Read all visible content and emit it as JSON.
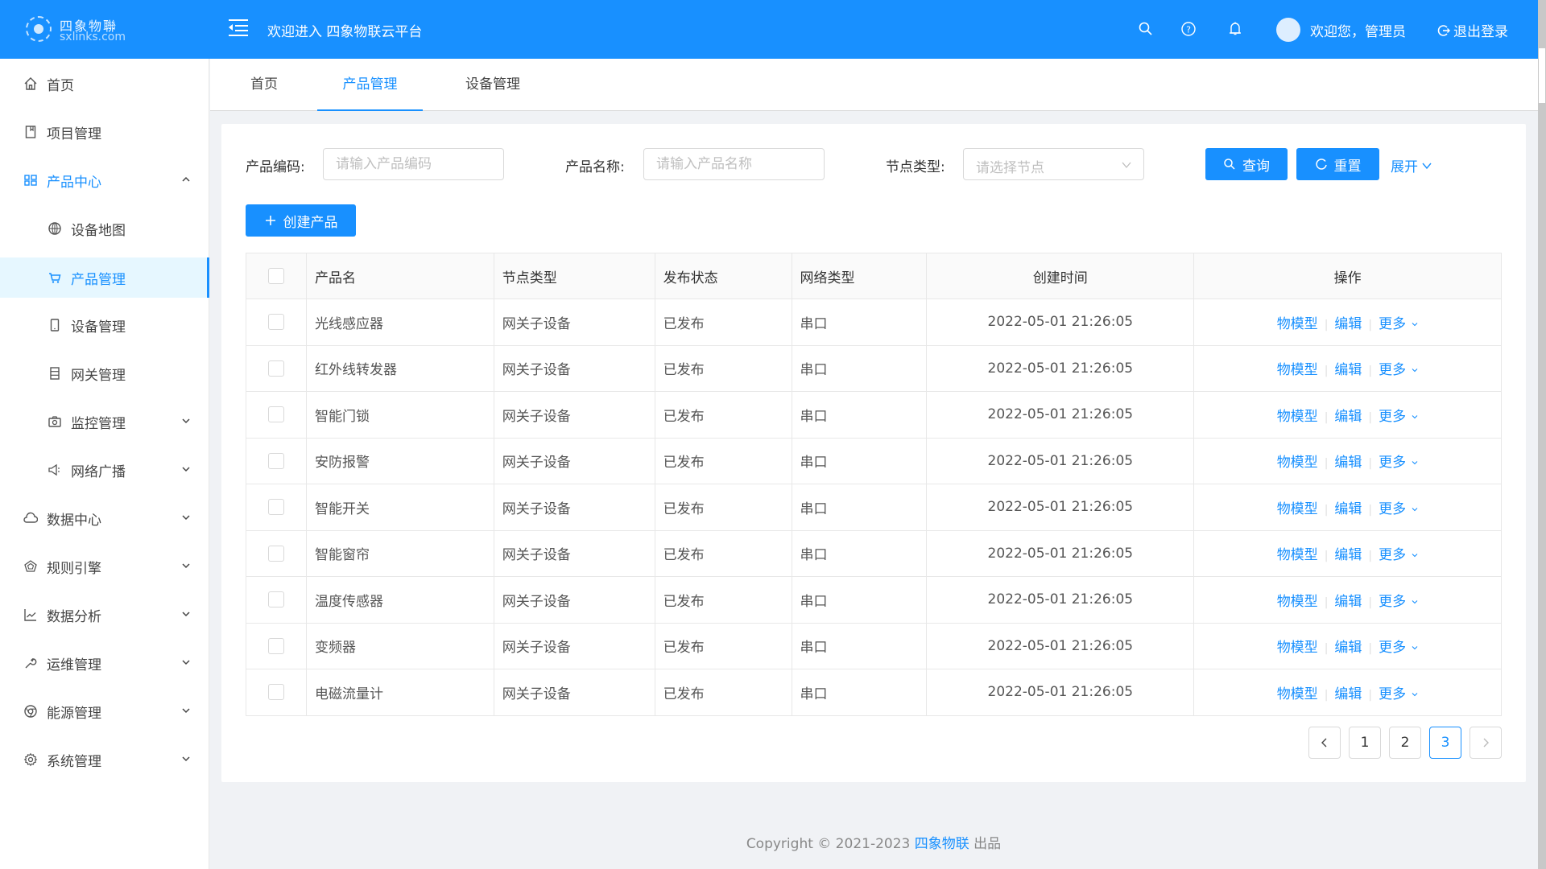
{
  "header": {
    "logo_cn": "四象物聯",
    "logo_en": "sxlinks.com",
    "title": "欢迎进入 四象物联云平台",
    "welcome": "欢迎您，管理员",
    "logout": "退出登录",
    "icons": [
      "menu-fold-icon",
      "search-icon",
      "help-icon",
      "bell-icon",
      "logout-icon"
    ]
  },
  "sidebar": {
    "items": [
      {
        "label": "首页",
        "icon": "home-icon"
      },
      {
        "label": "项目管理",
        "icon": "book-icon"
      },
      {
        "label": "产品中心",
        "icon": "appstore-icon",
        "expanded": true
      },
      {
        "label": "设备地图",
        "icon": "globe-icon"
      },
      {
        "label": "产品管理",
        "icon": "cart-icon",
        "active": true
      },
      {
        "label": "设备管理",
        "icon": "mobile-icon"
      },
      {
        "label": "网关管理",
        "icon": "server-icon"
      },
      {
        "label": "监控管理",
        "icon": "camera-icon"
      },
      {
        "label": "网络广播",
        "icon": "sound-icon"
      },
      {
        "label": "数据中心",
        "icon": "cloud-icon"
      },
      {
        "label": "规则引擎",
        "icon": "radar-icon"
      },
      {
        "label": "数据分析",
        "icon": "line-chart-icon"
      },
      {
        "label": "运维管理",
        "icon": "tool-icon"
      },
      {
        "label": "能源管理",
        "icon": "chrome-icon"
      },
      {
        "label": "系统管理",
        "icon": "setting-icon"
      }
    ]
  },
  "tabs": [
    {
      "label": "首页"
    },
    {
      "label": "产品管理",
      "active": true
    },
    {
      "label": "设备管理"
    }
  ],
  "filters": {
    "code_label": "产品编码:",
    "code_placeholder": "请输入产品编码",
    "name_label": "产品名称:",
    "name_placeholder": "请输入产品名称",
    "node_label": "节点类型:",
    "node_placeholder": "请选择节点",
    "query": "查询",
    "reset": "重置",
    "expand": "展开"
  },
  "create_button": "创建产品",
  "table": {
    "columns": [
      "产品名",
      "节点类型",
      "发布状态",
      "网络类型",
      "创建时间",
      "操作"
    ],
    "rows": [
      {
        "name": "光线感应器",
        "node": "网关子设备",
        "status": "已发布",
        "network": "串口",
        "created": "2022-05-01 21:26:05"
      },
      {
        "name": "红外线转发器",
        "node": "网关子设备",
        "status": "已发布",
        "network": "串口",
        "created": "2022-05-01 21:26:05"
      },
      {
        "name": "智能门锁",
        "node": "网关子设备",
        "status": "已发布",
        "network": "串口",
        "created": "2022-05-01 21:26:05"
      },
      {
        "name": "安防报警",
        "node": "网关子设备",
        "status": "已发布",
        "network": "串口",
        "created": "2022-05-01 21:26:05"
      },
      {
        "name": "智能开关",
        "node": "网关子设备",
        "status": "已发布",
        "network": "串口",
        "created": "2022-05-01 21:26:05"
      },
      {
        "name": "智能窗帘",
        "node": "网关子设备",
        "status": "已发布",
        "network": "串口",
        "created": "2022-05-01 21:26:05"
      },
      {
        "name": "温度传感器",
        "node": "网关子设备",
        "status": "已发布",
        "network": "串口",
        "created": "2022-05-01 21:26:05"
      },
      {
        "name": "变频器",
        "node": "网关子设备",
        "status": "已发布",
        "network": "串口",
        "created": "2022-05-01 21:26:05"
      },
      {
        "name": "电磁流量计",
        "node": "网关子设备",
        "status": "已发布",
        "network": "串口",
        "created": "2022-05-01 21:26:05"
      }
    ],
    "actions": {
      "model": "物模型",
      "edit": "编辑",
      "more": "更多"
    }
  },
  "pagination": {
    "pages": [
      "1",
      "2",
      "3"
    ],
    "current": "3"
  },
  "footer": {
    "prefix": "Copyright © 2021-2023",
    "brand": "四象物联",
    "suffix": "出品"
  },
  "colors": {
    "primary": "#1890ff",
    "background": "#f0f2f5"
  }
}
